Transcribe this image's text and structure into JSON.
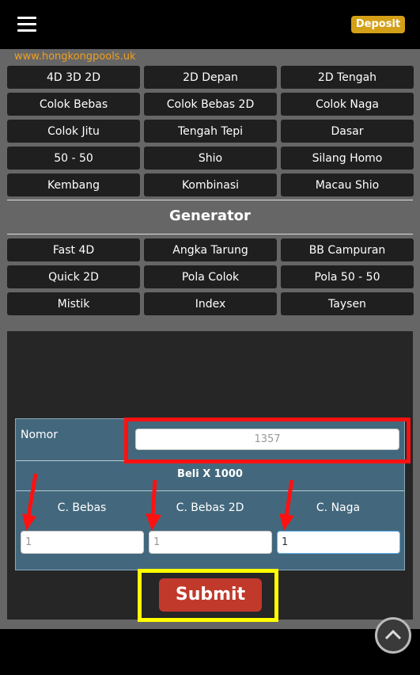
{
  "header": {
    "deposit_label": "Deposit",
    "site_url": "www.hongkongpools.uk"
  },
  "menu": [
    "4D 3D 2D",
    "2D Depan",
    "2D Tengah",
    "Colok Bebas",
    "Colok Bebas 2D",
    "Colok Naga",
    "Colok Jitu",
    "Tengah Tepi",
    "Dasar",
    "50 - 50",
    "Shio",
    "Silang Homo",
    "Kembang",
    "Kombinasi",
    "Macau Shio"
  ],
  "generator": {
    "title": "Generator",
    "items": [
      "Fast 4D",
      "Angka Tarung",
      "BB Campuran",
      "Quick 2D",
      "Pola Colok",
      "Pola 50 - 50",
      "Mistik",
      "Index",
      "Taysen"
    ]
  },
  "form": {
    "nomor_label": "Nomor",
    "nomor_placeholder": "1357",
    "beli_label": "Beli X 1000",
    "columns": [
      {
        "label": "C. Bebas",
        "value": "1"
      },
      {
        "label": "C. Bebas 2D",
        "value": "1"
      },
      {
        "label": "C. Naga",
        "value": "1"
      }
    ],
    "submit_label": "Submit"
  },
  "colors": {
    "deposit": "#d4a017",
    "url": "#f0a020",
    "submit": "#c0392b",
    "form_bg": "#43687d",
    "highlight_red": "#ff1111",
    "highlight_yellow": "#ffff00"
  },
  "icons": {
    "menu": "hamburger-menu-icon",
    "scroll_top": "chevron-up-icon"
  }
}
